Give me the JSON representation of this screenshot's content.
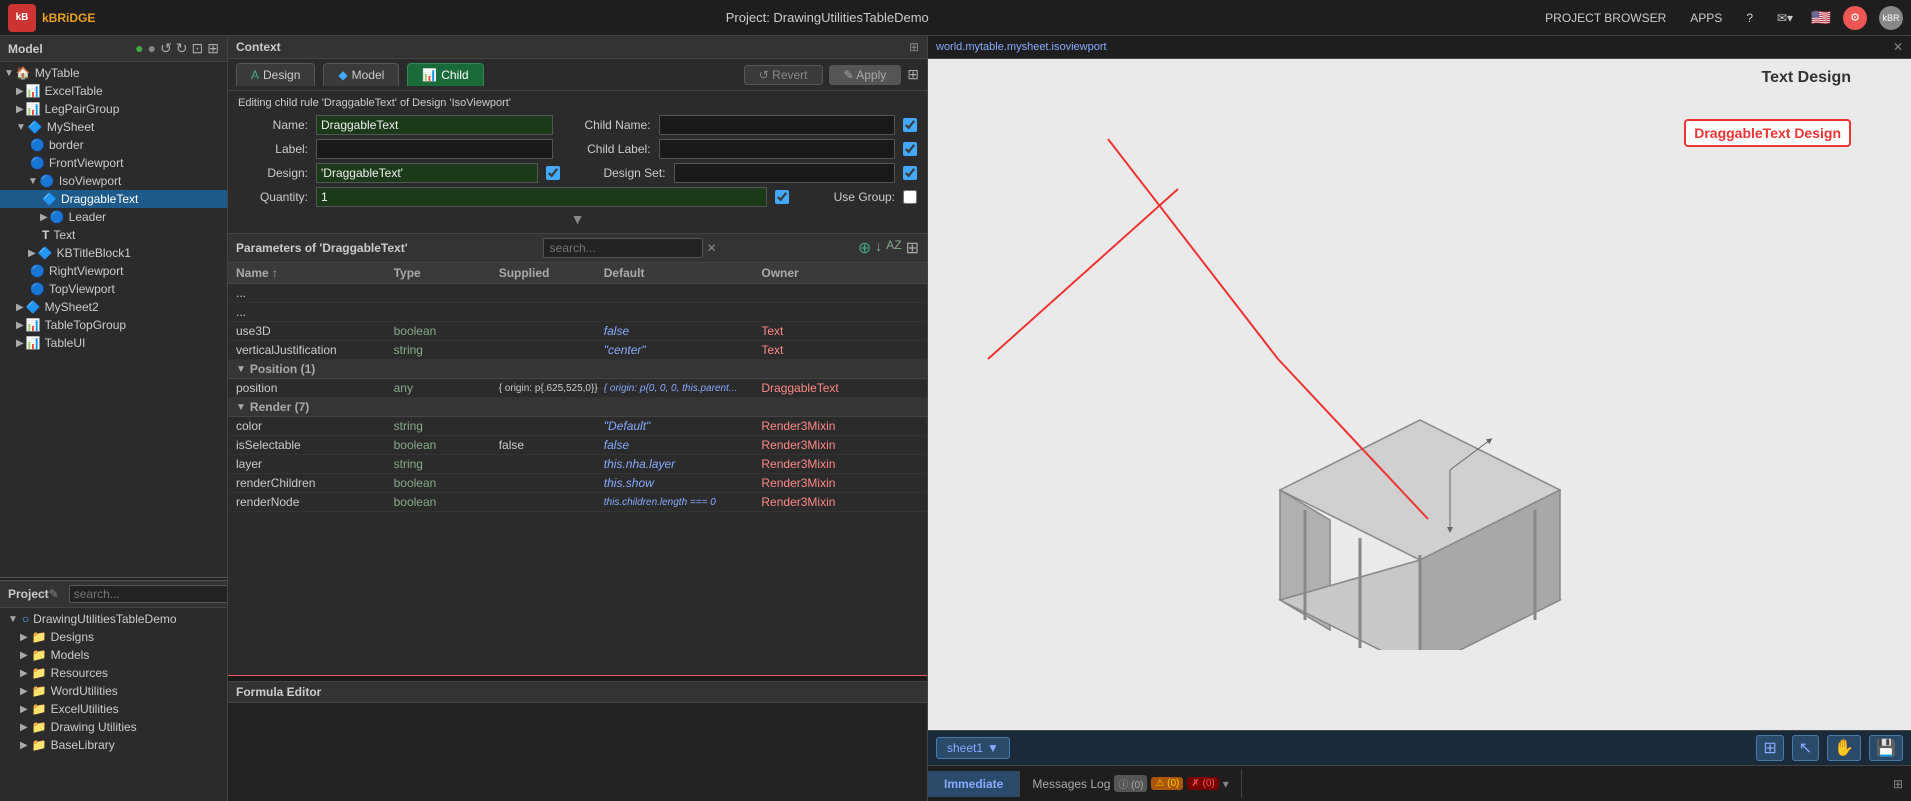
{
  "topbar": {
    "logo_text": "kBRiDGE",
    "project_title": "Project: DrawingUtilitiesTableDemo",
    "nav_items": [
      "PROJECT BROWSER",
      "APPS",
      "?"
    ],
    "close_label": "✕"
  },
  "left_panel": {
    "model_section_title": "Model",
    "model_header_icons": [
      "●",
      "○",
      "↺",
      "↻",
      "⊕",
      "⊞"
    ],
    "tree": [
      {
        "indent": 0,
        "arrow": "▼",
        "icon": "🏠",
        "label": "MyTable",
        "type": "table",
        "selected": false
      },
      {
        "indent": 1,
        "arrow": "▶",
        "icon": "📊",
        "label": "ExcelTable",
        "type": "group",
        "selected": false
      },
      {
        "indent": 1,
        "arrow": "▶",
        "icon": "📊",
        "label": "LegPairGroup",
        "type": "group",
        "selected": false
      },
      {
        "indent": 1,
        "arrow": "▼",
        "icon": "🔷",
        "label": "MySheet",
        "type": "sheet",
        "selected": false
      },
      {
        "indent": 2,
        "arrow": "",
        "icon": "🔵",
        "label": "border",
        "type": "view",
        "selected": false
      },
      {
        "indent": 2,
        "arrow": "",
        "icon": "🔵",
        "label": "FrontViewport",
        "type": "view",
        "selected": false
      },
      {
        "indent": 2,
        "arrow": "▼",
        "icon": "🔵",
        "label": "IsoViewport",
        "type": "view",
        "selected": false
      },
      {
        "indent": 3,
        "arrow": "",
        "icon": "🔷",
        "label": "DraggableText",
        "type": "text",
        "selected": true
      },
      {
        "indent": 3,
        "arrow": "▶",
        "icon": "🔵",
        "label": "Leader",
        "type": "view",
        "selected": false
      },
      {
        "indent": 3,
        "arrow": "",
        "icon": "T",
        "label": "Text",
        "type": "text",
        "selected": false
      },
      {
        "indent": 2,
        "arrow": "▶",
        "icon": "🔷",
        "label": "KBTitleBlock1",
        "type": "sheet",
        "selected": false
      },
      {
        "indent": 2,
        "arrow": "",
        "icon": "🔵",
        "label": "RightViewport",
        "type": "view",
        "selected": false
      },
      {
        "indent": 2,
        "arrow": "",
        "icon": "🔵",
        "label": "TopViewport",
        "type": "view",
        "selected": false
      },
      {
        "indent": 1,
        "arrow": "▶",
        "icon": "🔷",
        "label": "MySheet2",
        "type": "sheet",
        "selected": false
      },
      {
        "indent": 1,
        "arrow": "▶",
        "icon": "📊",
        "label": "TableTopGroup",
        "type": "group",
        "selected": false
      },
      {
        "indent": 1,
        "arrow": "▶",
        "icon": "📊",
        "label": "TableUI",
        "type": "ui",
        "selected": false
      }
    ],
    "project_section_title": "Project",
    "project_search_placeholder": "search...",
    "project_tree": [
      {
        "indent": 0,
        "arrow": "▼",
        "icon": "○",
        "label": "DrawingUtilitiesTableDemo",
        "type": "circle"
      },
      {
        "indent": 1,
        "arrow": "▶",
        "icon": "📁",
        "label": "Designs",
        "type": "folder"
      },
      {
        "indent": 1,
        "arrow": "▶",
        "icon": "📁",
        "label": "Models",
        "type": "folder"
      },
      {
        "indent": 1,
        "arrow": "▶",
        "icon": "📁",
        "label": "Resources",
        "type": "folder"
      },
      {
        "indent": 1,
        "arrow": "▶",
        "icon": "📁",
        "label": "WordUtilities",
        "type": "folder"
      },
      {
        "indent": 1,
        "arrow": "▶",
        "icon": "📁",
        "label": "ExcelUtilities",
        "type": "folder"
      },
      {
        "indent": 1,
        "arrow": "▶",
        "icon": "📁",
        "label": "Drawing Utilities",
        "type": "folder"
      },
      {
        "indent": 1,
        "arrow": "▶",
        "icon": "📁",
        "label": "BaseLibrary",
        "type": "folder"
      }
    ]
  },
  "context": {
    "title": "Context",
    "tabs": [
      {
        "label": "Design",
        "icon": "A",
        "active": false
      },
      {
        "label": "Model",
        "icon": "◆",
        "active": false
      },
      {
        "label": "Child",
        "icon": "📊",
        "active": true
      }
    ],
    "revert_label": "Revert",
    "apply_label": "Apply",
    "edit_title": "Editing child rule 'DraggableText' of Design 'IsoViewport'",
    "form": {
      "name_label": "Name:",
      "name_value": "DraggableText",
      "child_name_label": "Child Name:",
      "child_name_value": "",
      "label_label": "Label:",
      "label_value": "",
      "child_label_label": "Child Label:",
      "child_label_value": "",
      "design_label": "Design:",
      "design_value": "'DraggableText'",
      "design_set_label": "Design Set:",
      "design_set_value": "",
      "quantity_label": "Quantity:",
      "quantity_value": "1",
      "use_group_label": "Use Group:"
    }
  },
  "parameters": {
    "title": "Parameters of 'DraggableText'",
    "search_placeholder": "search...",
    "columns": [
      "Name ↑",
      "Type",
      "Supplied",
      "Default",
      "Owner"
    ],
    "rows": [
      {
        "name": "use3D",
        "type": "boolean",
        "supplied": "",
        "default": "false",
        "owner": "Text"
      },
      {
        "name": "verticalJustification",
        "type": "string",
        "supplied": "",
        "default": "\"center\"",
        "owner": "Text"
      },
      {
        "section": "Position (1)"
      },
      {
        "name": "position",
        "type": "any",
        "supplied": "{ origin: p{.625,525,0}}",
        "default": "{ origin: p{0, 0, 0, this.parent...",
        "owner": "DraggableText"
      },
      {
        "section": "Render (7)"
      },
      {
        "name": "color",
        "type": "string",
        "supplied": "",
        "default": "\"Default\"",
        "owner": "Render3Mixin"
      },
      {
        "name": "isSelectable",
        "type": "boolean",
        "supplied": "false",
        "default": "false",
        "owner": "Render3Mixin"
      },
      {
        "name": "layer",
        "type": "string",
        "supplied": "",
        "default": "this.nha.layer",
        "owner": "Render3Mixin"
      },
      {
        "name": "renderChildren",
        "type": "boolean",
        "supplied": "",
        "default": "this.show",
        "owner": "Render3Mixin"
      },
      {
        "name": "renderNode",
        "type": "boolean",
        "supplied": "",
        "default": "this.children.length === 0",
        "owner": "Render3Mixin"
      }
    ]
  },
  "formula_editor": {
    "title": "Formula Editor"
  },
  "right_panel": {
    "path": "world.mytable.mysheet.isoviewport",
    "viewport_title": "Text Design",
    "design_label": "DraggableText Design",
    "sheet_btn": "sheet1",
    "sheet_arrow": "▼",
    "immediate_tab": "Immediate",
    "messages_tab": "Messages Log",
    "msg_info": "ⓘ (0)",
    "msg_warn": "⚠ (0)",
    "msg_err": "✗ (0)"
  }
}
